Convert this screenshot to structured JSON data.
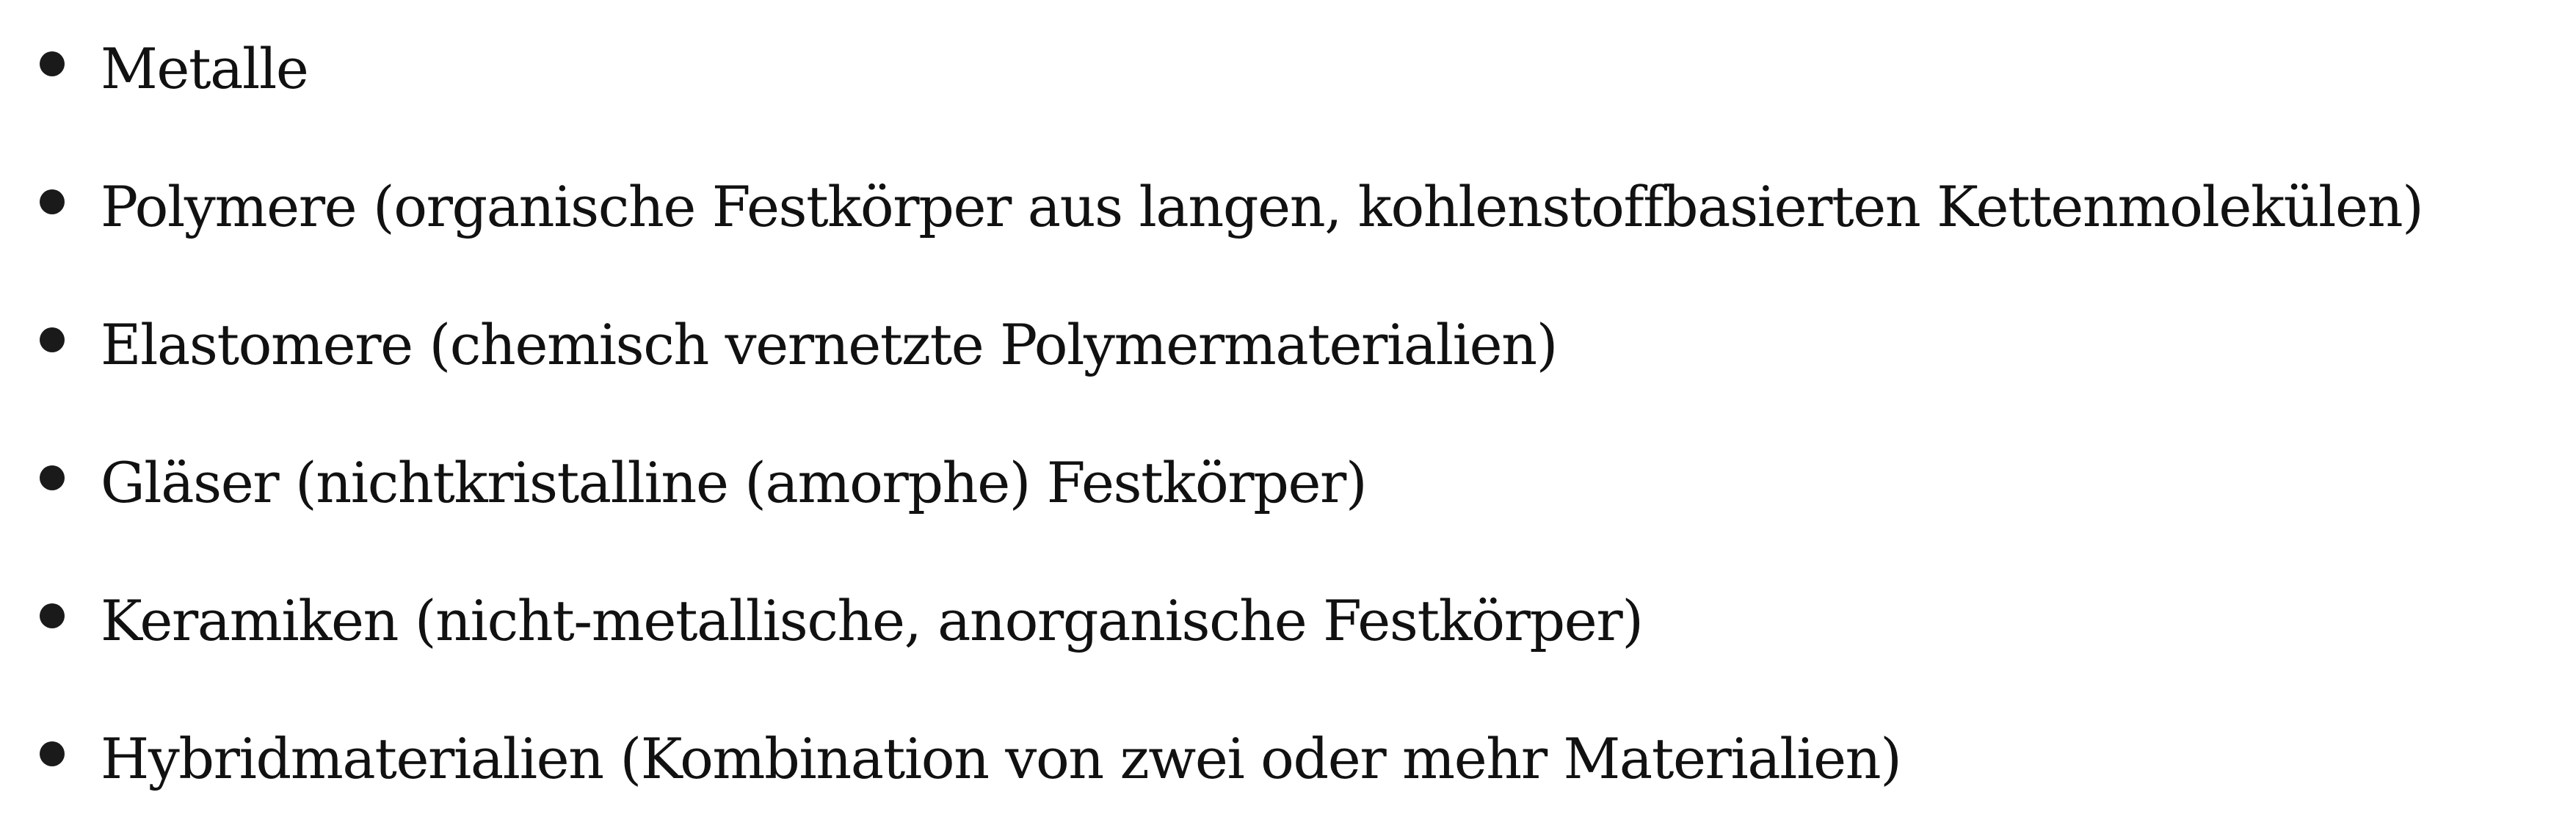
{
  "items": [
    {
      "text": "Metalle"
    },
    {
      "text": "Polymere (organische Festkörper aus langen, kohlenstoffbasierten Kettenmolekülen)"
    },
    {
      "text": "Elastomere (chemisch vernetzte Polymermaterialien)"
    },
    {
      "text": "Gläser (nichtkristalline (amorphe) Festkörper)"
    },
    {
      "text": "Keramiken (nicht-metallische, anorganische Festkörper)"
    },
    {
      "text": "Hybridmaterialien (Kombination von zwei oder mehr Materialien)"
    }
  ]
}
